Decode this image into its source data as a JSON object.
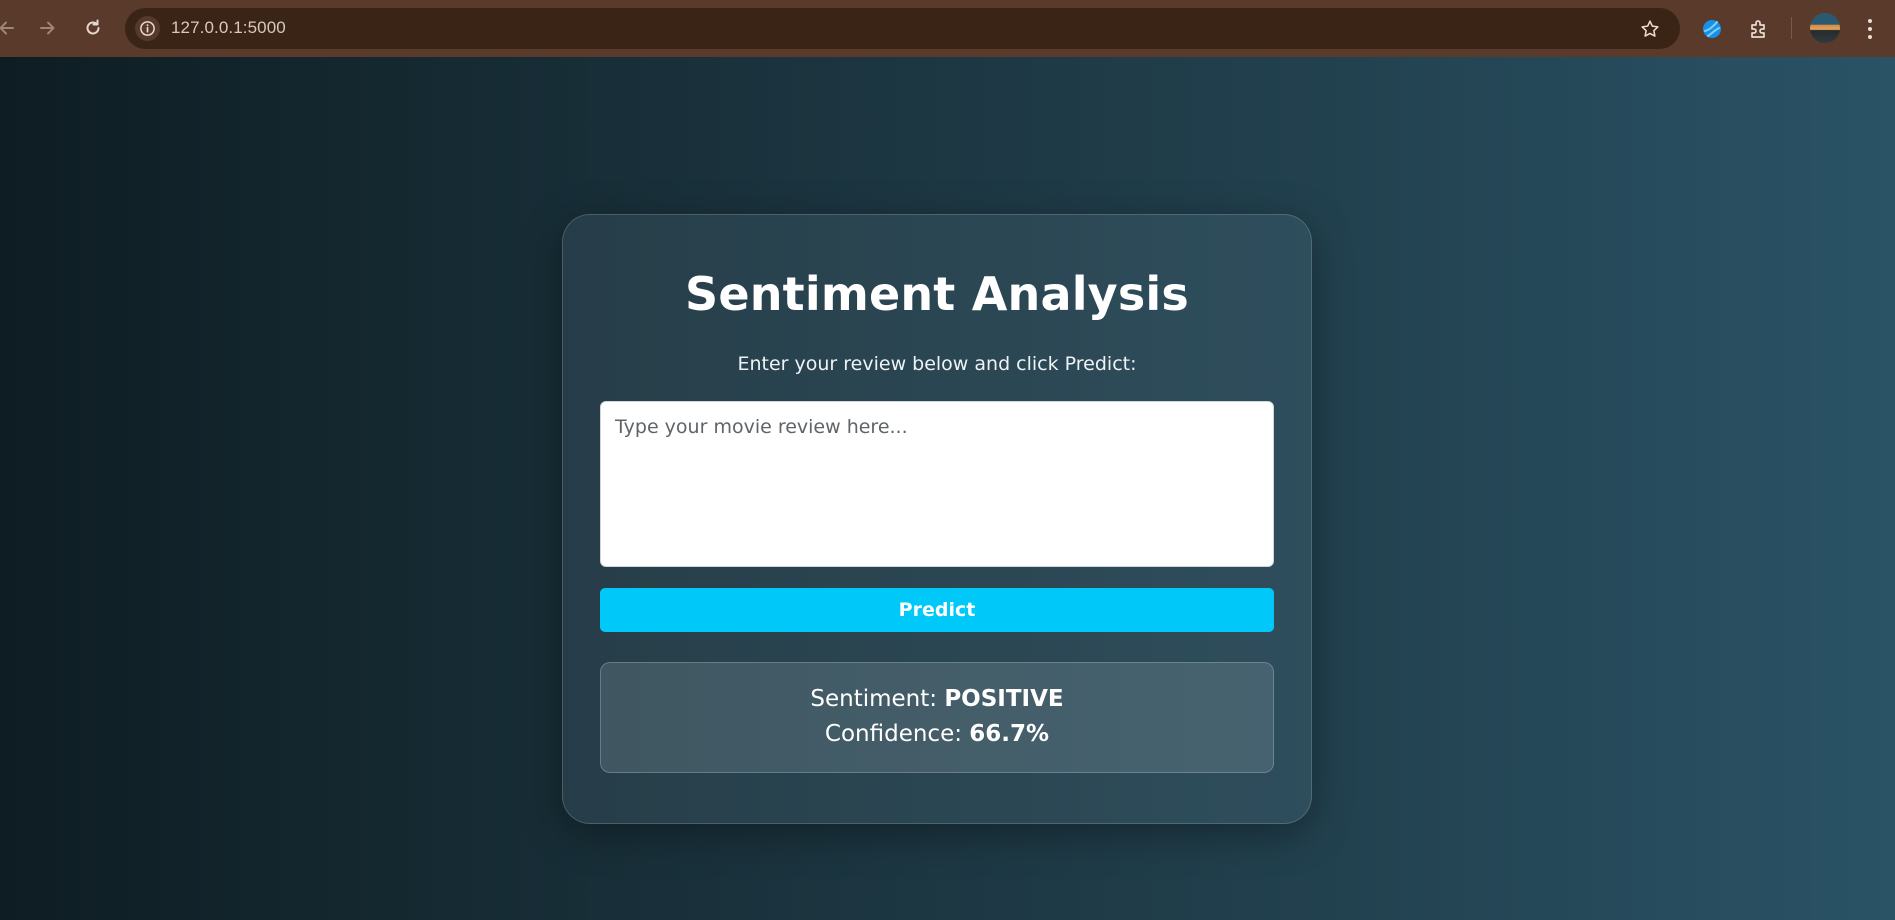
{
  "browser": {
    "url": "127.0.0.1:5000",
    "toolbar_color": "#5a3a2a",
    "omnibox_color": "#3a2416",
    "icons": [
      "back-arrow-icon",
      "forward-arrow-icon",
      "reload-icon",
      "info-icon",
      "star-icon",
      "extension-icon",
      "puzzle-icon",
      "avatar",
      "kebab-menu-icon"
    ]
  },
  "app": {
    "title": "Sentiment Analysis",
    "subtitle": "Enter your review below and click Predict:",
    "review": {
      "value": "",
      "placeholder": "Type your movie review here..."
    },
    "predict_label": "Predict",
    "result": {
      "sentiment_label": "Sentiment:",
      "sentiment_value": "POSITIVE",
      "confidence_label": "Confidence:",
      "confidence_value": "66.7%"
    }
  },
  "colors": {
    "button": "#00c8f8",
    "background_left": "#0e1d23",
    "background_right": "#2a5366",
    "text": "#ffffff"
  }
}
